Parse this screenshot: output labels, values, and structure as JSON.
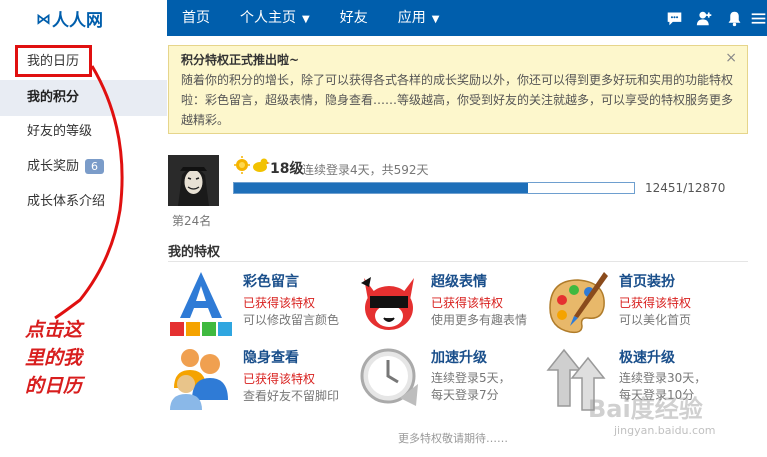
{
  "header": {
    "logo_text": "人人网",
    "nav": [
      {
        "label": "首页"
      },
      {
        "label": "个人主页",
        "has_dropdown": true
      },
      {
        "label": "好友"
      },
      {
        "label": "应用",
        "has_dropdown": true
      }
    ],
    "icons": [
      "chat-icon",
      "add-friend-icon",
      "notification-bell-icon"
    ]
  },
  "sidebar": {
    "items": [
      {
        "label": "我的日历"
      },
      {
        "label": "我的积分",
        "active": true
      },
      {
        "label": "好友的等级"
      },
      {
        "label": "成长奖励",
        "badge": "6"
      },
      {
        "label": "成长体系介绍"
      }
    ]
  },
  "notice": {
    "title": "积分特权正式推出啦~",
    "body": "随着你的积分的增长，除了可以获得各式各样的成长奖励以外，你还可以得到更多好玩和实用的功能特权啦：彩色留言，超级表情，隐身查看……等级越高，你受到好友的关注就越多，可以享受的特权服务更多越精彩。",
    "close": "×"
  },
  "profile": {
    "rank": "第24名",
    "level": "18级",
    "login_info": "连续登录4天，共592天",
    "progress_text": "12451/12870",
    "progress_fraction": 0.735
  },
  "privileges": {
    "title": "我的特权",
    "items": [
      {
        "title": "彩色留言",
        "status": "已获得该特权",
        "desc": "可以修改留言颜色"
      },
      {
        "title": "超级表情",
        "status": "已获得该特权",
        "desc": "使用更多有趣表情"
      },
      {
        "title": "首页装扮",
        "status": "已获得该特权",
        "desc": "可以美化首页"
      },
      {
        "title": "隐身查看",
        "status": "已获得该特权",
        "desc": "查看好友不留脚印"
      },
      {
        "title": "加速升级",
        "status": "",
        "desc": "连续登录5天，\n每天登录7分"
      },
      {
        "title": "极速升级",
        "status": "",
        "desc": "连续登录30天，\n每天登录10分"
      }
    ],
    "more": "更多特权敬请期待……"
  },
  "annotation": {
    "lines": [
      "点击这",
      "里的我",
      "的日历"
    ]
  },
  "watermark": {
    "text": "Bai度经验",
    "sub": "jingyan.baidu.com"
  },
  "colors": {
    "header_bg": "#005eac",
    "annotation": "#d81e1e",
    "link_title": "#1a4f8b",
    "status_red": "#d8201e",
    "notice_bg": "#fdf7cc"
  }
}
